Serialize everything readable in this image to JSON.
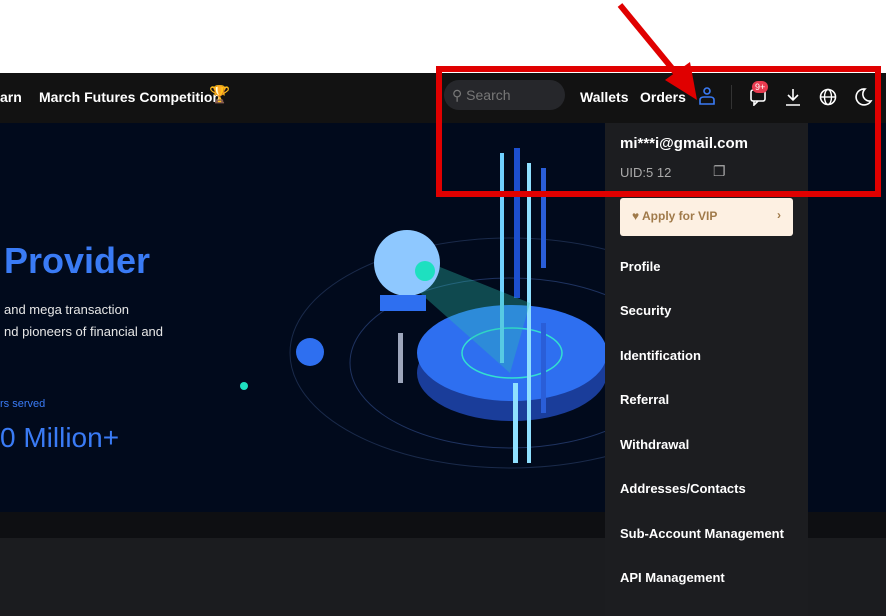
{
  "nav": {
    "earn": "arn",
    "competition": "March Futures Competition",
    "search_placeholder": "Search",
    "wallets": "Wallets",
    "orders": "Orders",
    "badge": "9+"
  },
  "hero": {
    "title": "Provider",
    "line1": "and mega transaction",
    "line2": "nd pioneers of financial and",
    "served": "rs served",
    "big": "0 Million+"
  },
  "dropdown": {
    "email": "mi***i@gmail.com",
    "uid": "UID:5      12",
    "vip": "Apply for VIP",
    "items": [
      "Profile",
      "Security",
      "Identification",
      "Referral",
      "Withdrawal",
      "Addresses/Contacts",
      "Sub-Account Management",
      "API Management"
    ]
  },
  "colors": {
    "accent": "#3a7bf5",
    "annotation": "#e00000"
  }
}
